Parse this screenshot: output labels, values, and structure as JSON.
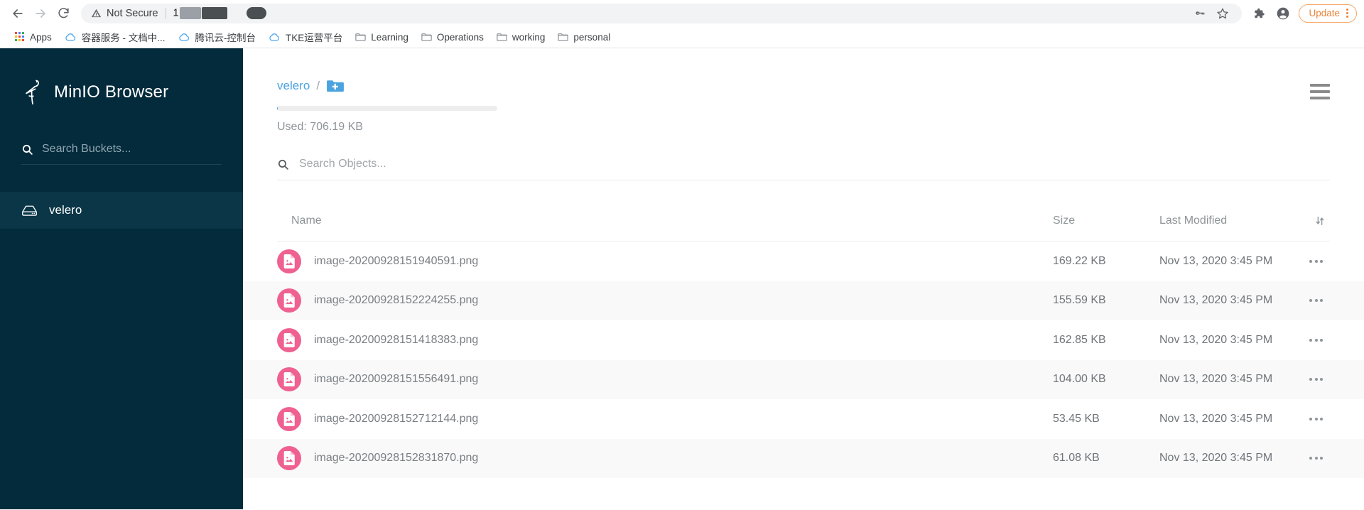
{
  "browser": {
    "nav": {
      "back_icon": "arrow-left-icon",
      "forward_icon": "arrow-right-icon",
      "reload_icon": "reload-icon"
    },
    "omnibox": {
      "security_label": "Not Secure",
      "security_icon": "warning-triangle-icon",
      "url_prefix": "1",
      "url_redacted": true,
      "key_icon": "key-icon",
      "bookmark_icon": "star-icon"
    },
    "toolbar_right": {
      "extensions_icon": "puzzle-piece-icon",
      "profile_icon": "account-circle-icon",
      "update_label": "Update",
      "menu_icon": "kebab-menu-icon"
    },
    "bookmarks": [
      {
        "label": "Apps",
        "icon": "apps-grid-icon"
      },
      {
        "label": "容器服务 - 文档中...",
        "icon": "cloud-icon"
      },
      {
        "label": "腾讯云-控制台",
        "icon": "cloud-icon"
      },
      {
        "label": "TKE运营平台",
        "icon": "cloud-icon"
      },
      {
        "label": "Learning",
        "icon": "folder-icon"
      },
      {
        "label": "Operations",
        "icon": "folder-icon"
      },
      {
        "label": "working",
        "icon": "folder-icon"
      },
      {
        "label": "personal",
        "icon": "folder-icon"
      }
    ]
  },
  "sidebar": {
    "logo_icon": "minio-flamingo-logo",
    "title": "MinIO Browser",
    "search": {
      "icon": "search-icon",
      "placeholder": "Search Buckets..."
    },
    "buckets": [
      {
        "label": "velero",
        "icon": "bucket-icon",
        "active": true
      }
    ]
  },
  "main": {
    "breadcrumb": {
      "bucket": "velero",
      "separator": "/",
      "new_folder_icon": "folder-plus-icon"
    },
    "menu_icon": "hamburger-menu-icon",
    "usage": {
      "label": "Used: 706.19 KB",
      "percent": 0.2
    },
    "search": {
      "icon": "search-icon",
      "placeholder": "Search Objects..."
    },
    "table": {
      "headers": {
        "name": "Name",
        "size": "Size",
        "last_modified": "Last Modified",
        "sort_icon": "sort-arrows-icon"
      },
      "rows": [
        {
          "name": "image-20200928151940591.png",
          "size": "169.22 KB",
          "modified": "Nov 13, 2020 3:45 PM",
          "icon": "image-file-icon",
          "actions_icon": "more-options-icon"
        },
        {
          "name": "image-20200928152224255.png",
          "size": "155.59 KB",
          "modified": "Nov 13, 2020 3:45 PM",
          "icon": "image-file-icon",
          "actions_icon": "more-options-icon"
        },
        {
          "name": "image-20200928151418383.png",
          "size": "162.85 KB",
          "modified": "Nov 13, 2020 3:45 PM",
          "icon": "image-file-icon",
          "actions_icon": "more-options-icon"
        },
        {
          "name": "image-20200928151556491.png",
          "size": "104.00 KB",
          "modified": "Nov 13, 2020 3:45 PM",
          "icon": "image-file-icon",
          "actions_icon": "more-options-icon"
        },
        {
          "name": "image-20200928152712144.png",
          "size": "53.45 KB",
          "modified": "Nov 13, 2020 3:45 PM",
          "icon": "image-file-icon",
          "actions_icon": "more-options-icon"
        },
        {
          "name": "image-20200928152831870.png",
          "size": "61.08 KB",
          "modified": "Nov 13, 2020 3:45 PM",
          "icon": "image-file-icon",
          "actions_icon": "more-options-icon"
        }
      ]
    }
  },
  "colors": {
    "sidebar_bg": "#032b3c",
    "sidebar_active": "#0a3647",
    "accent_blue": "#4aa3df",
    "file_icon_pink": "#ef6191",
    "update_orange": "#e8833a",
    "row_alt": "#f9f9f9"
  }
}
